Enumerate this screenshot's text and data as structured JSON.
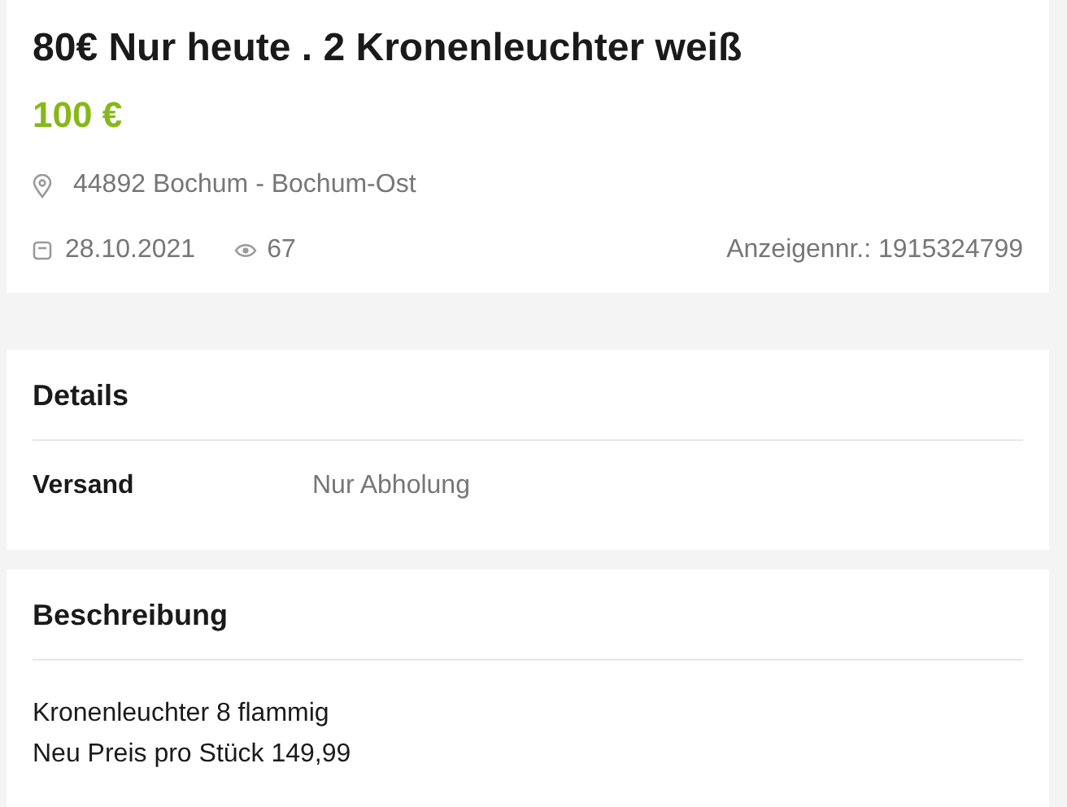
{
  "listing": {
    "title": "80€ Nur heute . 2 Kronenleuchter weiß",
    "price": "100 €",
    "location": "44892 Bochum - Bochum-Ost",
    "date": "28.10.2021",
    "views": "67",
    "ad_number": "Anzeigennr.: 1915324799"
  },
  "details": {
    "heading": "Details",
    "rows": [
      {
        "label": "Versand",
        "value": "Nur Abholung"
      }
    ]
  },
  "description": {
    "heading": "Beschreibung",
    "lines": [
      "Kronenleuchter 8 flammig",
      "Neu Preis pro Stück 149,99"
    ]
  }
}
